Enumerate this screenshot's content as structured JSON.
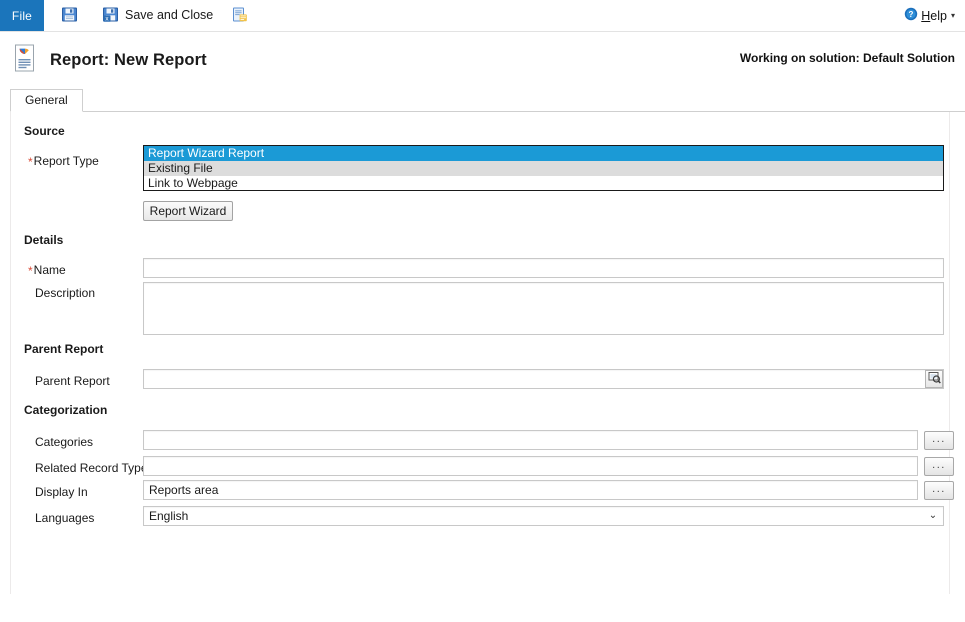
{
  "ribbon": {
    "file_tab": "File",
    "buttons": [
      {
        "name": "save-button",
        "icon": "save-icon",
        "label": ""
      },
      {
        "name": "save-and-close-button",
        "icon": "save-and-close-icon",
        "label": "Save and Close"
      },
      {
        "name": "save-as-new-button",
        "icon": "new-record-icon",
        "label": ""
      }
    ],
    "help": {
      "label_prefix": "H",
      "label_rest": "elp",
      "icon": "help-icon",
      "caret": "▾"
    }
  },
  "header": {
    "icon": "report-icon",
    "title": "Report: New Report",
    "solution": "Working on solution: Default Solution"
  },
  "tabs": [
    {
      "label": "General",
      "selected": true
    }
  ],
  "form": {
    "sections": {
      "source": {
        "heading": "Source",
        "report_type": {
          "label": "Report Type",
          "required": true,
          "options": [
            "Report Wizard Report",
            "Existing File",
            "Link to Webpage"
          ],
          "selected": "Report Wizard Report"
        },
        "report_wizard_button": "Report Wizard"
      },
      "details": {
        "heading": "Details",
        "name": {
          "label": "Name",
          "required": true,
          "value": ""
        },
        "description": {
          "label": "Description",
          "required": false,
          "value": ""
        }
      },
      "parent_report": {
        "heading": "Parent Report",
        "field": {
          "label": "Parent Report",
          "value": ""
        },
        "lookup_icon": "lookup-icon"
      },
      "categorization": {
        "heading": "Categorization",
        "categories": {
          "label": "Categories",
          "value": "",
          "button": "..."
        },
        "related_record_types": {
          "label": "Related Record Types",
          "value": "",
          "button": "..."
        },
        "display_in": {
          "label": "Display In",
          "value": "Reports area",
          "button": "..."
        },
        "languages": {
          "label": "Languages",
          "value": "English",
          "caret": "⌄"
        }
      }
    }
  },
  "colors": {
    "file_tab_blue": "#1b75bb",
    "selection_blue": "#1b9ad6",
    "required_red": "#d94c38",
    "alt_row_gray": "#dcdcdc"
  }
}
